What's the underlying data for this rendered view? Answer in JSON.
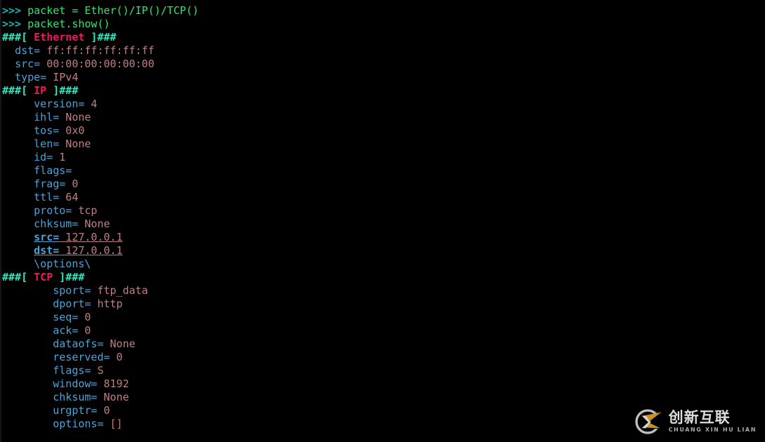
{
  "terminal": {
    "prompt_symbol": ">>>",
    "commands": [
      {
        "prompt": ">>> ",
        "text": "packet = Ether()/IP()/TCP()"
      },
      {
        "prompt": ">>> ",
        "text": "packet.show()"
      }
    ],
    "layers": [
      {
        "header_open": "###[ ",
        "name": "Ethernet",
        "header_close": " ]###",
        "indent": "  ",
        "fields": [
          {
            "name": "dst=",
            "value": " ff:ff:ff:ff:ff:ff",
            "underline": false
          },
          {
            "name": "src=",
            "value": " 00:00:00:00:00:00",
            "underline": false
          },
          {
            "name": "type=",
            "value": " IPv4",
            "underline": false
          }
        ]
      },
      {
        "header_open": "###[ ",
        "name": "IP",
        "header_close": " ]###",
        "indent": "     ",
        "fields": [
          {
            "name": "version=",
            "value": " 4",
            "underline": false
          },
          {
            "name": "ihl=",
            "value": " None",
            "underline": false
          },
          {
            "name": "tos=",
            "value": " 0x0",
            "underline": false
          },
          {
            "name": "len=",
            "value": " None",
            "underline": false
          },
          {
            "name": "id=",
            "value": " 1",
            "underline": false
          },
          {
            "name": "flags=",
            "value": "",
            "underline": false
          },
          {
            "name": "frag=",
            "value": " 0",
            "underline": false
          },
          {
            "name": "ttl=",
            "value": " 64",
            "underline": false
          },
          {
            "name": "proto=",
            "value": " tcp",
            "underline": false
          },
          {
            "name": "chksum=",
            "value": " None",
            "underline": false
          },
          {
            "name": "src=",
            "value": " 127.0.0.1",
            "underline": true
          },
          {
            "name": "dst=",
            "value": " 127.0.0.1",
            "underline": true
          }
        ],
        "options_line": "\\options\\"
      },
      {
        "header_open": "###[ ",
        "name": "TCP",
        "header_close": " ]###",
        "indent": "        ",
        "fields": [
          {
            "name": "sport=",
            "value": " ftp_data",
            "underline": false
          },
          {
            "name": "dport=",
            "value": " http",
            "underline": false
          },
          {
            "name": "seq=",
            "value": " 0",
            "underline": false
          },
          {
            "name": "ack=",
            "value": " 0",
            "underline": false
          },
          {
            "name": "dataofs=",
            "value": " None",
            "underline": false
          },
          {
            "name": "reserved=",
            "value": " 0",
            "underline": false
          },
          {
            "name": "flags=",
            "value": " S",
            "underline": false
          },
          {
            "name": "window=",
            "value": " 8192",
            "underline": false
          },
          {
            "name": "chksum=",
            "value": " None",
            "underline": false
          },
          {
            "name": "urgptr=",
            "value": " 0",
            "underline": false
          },
          {
            "name": "options=",
            "value": " []",
            "underline": false
          }
        ]
      }
    ]
  },
  "watermark": {
    "logo_name": "cx-logo-icon",
    "chinese_text": "创新互联",
    "pinyin_text": "CHUANG XIN HU LIAN"
  },
  "colors": {
    "background": "#000000",
    "prompt": "#18b2b2",
    "command": "#2ee66b",
    "hashes": "#2ee6c0",
    "layer_name": "#f0195a",
    "field_name": "#4aa3d8",
    "field_value": "#c07f80",
    "watermark_gold": "#d8a126",
    "watermark_grey": "#cfcfcf"
  }
}
